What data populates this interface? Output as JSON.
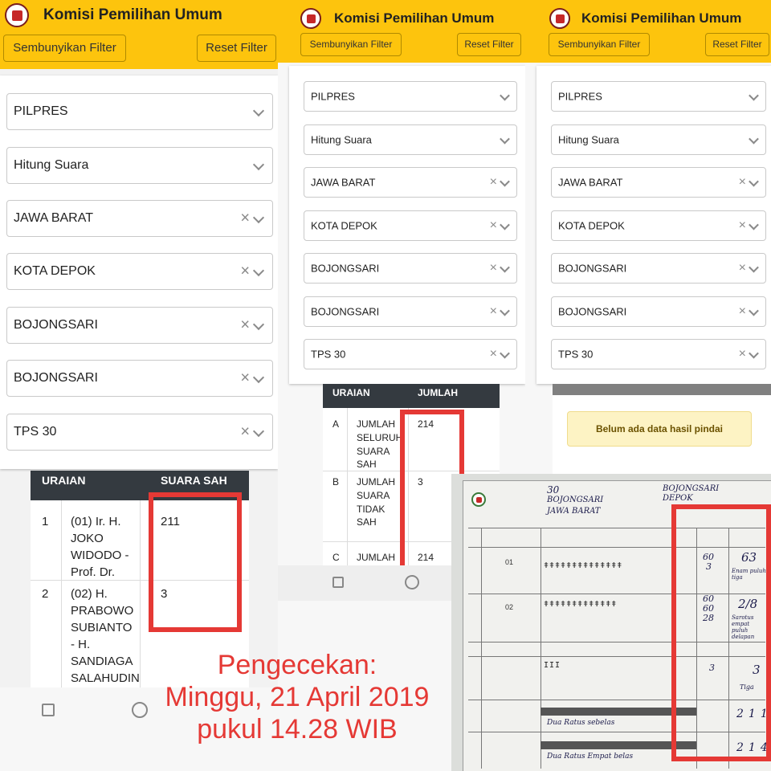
{
  "brand": {
    "title": "Komisi Pemilihan Umum"
  },
  "buttons": {
    "hide_filter": "Sembunyikan Filter",
    "reset_filter": "Reset Filter"
  },
  "filters": [
    "PILPRES",
    "Hitung Suara",
    "JAWA BARAT",
    "KOTA DEPOK",
    "BOJONGSARI",
    "BOJONGSARI",
    "TPS 30"
  ],
  "icons": {
    "clear": "×"
  },
  "table1": {
    "headers": [
      "URAIAN",
      "SUARA SAH"
    ],
    "rows": [
      {
        "no": "1",
        "name": "(01) Ir. H. JOKO WIDODO - Prof. Dr.",
        "votes": "211"
      },
      {
        "no": "2",
        "name": "(02) H. PRABOWO SUBIANTO - H. SANDIAGA SALAHUDIN",
        "votes": "3"
      }
    ]
  },
  "table2": {
    "headers": [
      "URAIAN",
      "JUMLAH"
    ],
    "rows": [
      {
        "letter": "A",
        "desc": "JUMLAH SELURUH SUARA SAH",
        "value": "214"
      },
      {
        "letter": "B",
        "desc": "JUMLAH SUARA TIDAK SAH",
        "value": "3"
      },
      {
        "letter": "C",
        "desc": "JUMLAH",
        "value": "214"
      }
    ]
  },
  "notice": "Belum ada data hasil pindai",
  "caption": {
    "line1": "Pengecekan:",
    "line2": "Minggu, 21 April 2019",
    "line3": "pukul 14.28 WIB"
  },
  "c1_form": {
    "tps": "30",
    "kelurahan": "BOJONGSARI",
    "provinsi": "JAWA BARAT",
    "kota": "BOJONGSARI DEPOK",
    "cand1": {
      "num": "01",
      "votes_a": "60",
      "votes_b": "3",
      "total": "63",
      "words": "Enam puluh tiga"
    },
    "cand2": {
      "num": "02",
      "votes_a": "60",
      "votes_b": "60",
      "votes_c": "28",
      "total": "2/8",
      "words": "Sarotus empat puluh delapan"
    },
    "invalid": {
      "tally": "III",
      "value": "3",
      "total": "3",
      "words": "Tiga"
    },
    "total_valid": {
      "value": "211",
      "words": "Dua Ratus sebelas"
    },
    "total_all": {
      "value": "214",
      "words": "Dua Ratus Empat belas"
    }
  },
  "colors": {
    "header": "#fdc40d",
    "table_header": "#343a40",
    "highlight": "#e53935"
  }
}
